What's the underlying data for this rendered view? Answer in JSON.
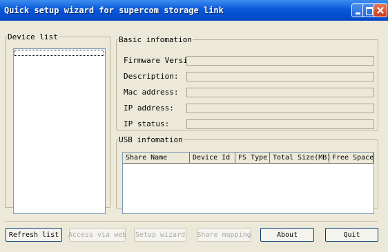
{
  "window": {
    "title": "Quick setup wizard for supercom storage link"
  },
  "device_list": {
    "legend": "Device list",
    "items": [
      ""
    ]
  },
  "basic": {
    "legend": "Basic infomation",
    "fields": [
      {
        "label": "Firmware Version:",
        "value": ""
      },
      {
        "label": "Description:",
        "value": ""
      },
      {
        "label": "Mac address:",
        "value": ""
      },
      {
        "label": "IP address:",
        "value": ""
      },
      {
        "label": "IP status:",
        "value": ""
      }
    ]
  },
  "usb": {
    "legend": "USB infomation",
    "columns": [
      "Share Name",
      "Device Id",
      "FS Type",
      "Total Size(MB)",
      "Free Space"
    ],
    "rows": []
  },
  "buttons": {
    "refresh": "Refresh list",
    "access": "Access via web",
    "setup": "Setup wizard",
    "share": "Share mapping",
    "about": "About",
    "quit": "Quit"
  }
}
